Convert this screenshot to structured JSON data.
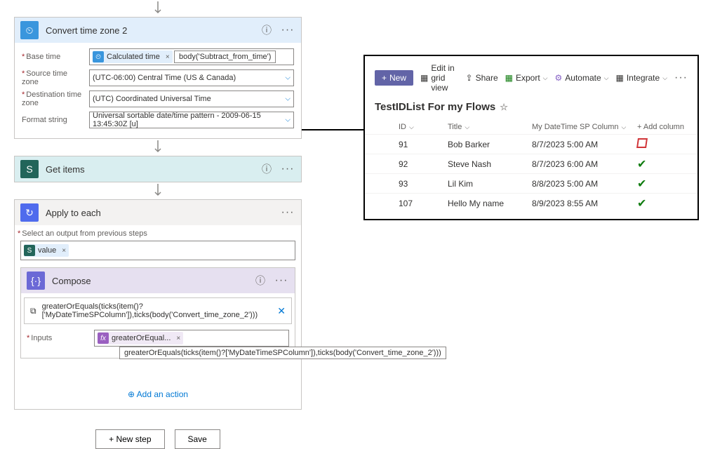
{
  "convert": {
    "title": "Convert time zone 2",
    "baseTimeLabel": "Base time",
    "baseTimeToken": "Calculated time",
    "baseTimeTooltip": "body('Subtract_from_time')",
    "sourceLabel": "Source time zone",
    "sourceValue": "(UTC-06:00) Central Time (US & Canada)",
    "destLabel": "Destination time zone",
    "destValue": "(UTC) Coordinated Universal Time",
    "formatLabel": "Format string",
    "formatValue": "Universal sortable date/time pattern - 2009-06-15 13:45:30Z [u]"
  },
  "getItems": {
    "title": "Get items"
  },
  "applyEach": {
    "title": "Apply to each",
    "outputLabel": "Select an output from previous steps",
    "valueToken": "value"
  },
  "compose": {
    "title": "Compose",
    "expression": "greaterOrEquals(ticks(item()?['MyDateTimeSPColumn']),ticks(body('Convert_time_zone_2')))",
    "inputsLabel": "Inputs",
    "inputsToken": "greaterOrEqual...",
    "tooltip": "greaterOrEquals(ticks(item()?['MyDateTimeSPColumn']),ticks(body('Convert_time_zone_2')))",
    "addAction": "Add an action"
  },
  "footer": {
    "newStep": "+ New step",
    "save": "Save"
  },
  "sp": {
    "new": "New",
    "editGrid": "Edit in grid view",
    "share": "Share",
    "export": "Export",
    "automate": "Automate",
    "integrate": "Integrate",
    "listTitle": "TestIDList For my Flows",
    "cols": {
      "id": "ID",
      "title": "Title",
      "dt": "My DateTime SP Column",
      "add": "Add column"
    },
    "rows": [
      {
        "id": "91",
        "title": "Bob Barker",
        "dt": "8/7/2023 5:00 AM",
        "state": "red"
      },
      {
        "id": "92",
        "title": "Steve Nash",
        "dt": "8/7/2023 6:00 AM",
        "state": "green"
      },
      {
        "id": "93",
        "title": "Lil Kim",
        "dt": "8/8/2023 5:00 AM",
        "state": "green"
      },
      {
        "id": "107",
        "title": "Hello My name",
        "dt": "8/9/2023 8:55 AM",
        "state": "green"
      }
    ]
  }
}
